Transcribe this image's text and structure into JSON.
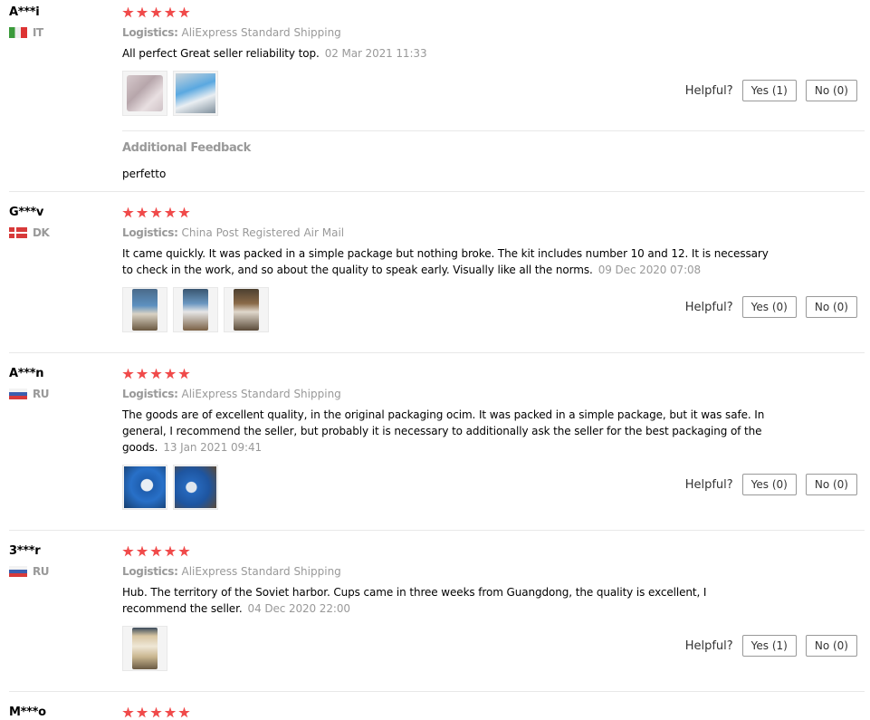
{
  "helpful_label": "Helpful?",
  "logistics_label": "Logistics:",
  "colors": {
    "star": "#f04a4a",
    "muted": "#999999",
    "border": "#e8e8e8"
  },
  "reviews": [
    {
      "user": "A***i",
      "country": "IT",
      "flag": "it",
      "rating": 5,
      "logistics": "AliExpress Standard Shipping",
      "content": "All perfect Great seller reliability top.",
      "date": "02 Mar 2021 11:33",
      "yes": "Yes (1)",
      "no": "No (0)",
      "additional_feedback": {
        "title": "Additional Feedback",
        "text": "perfetto"
      }
    },
    {
      "user": "G***v",
      "country": "DK",
      "flag": "dk",
      "rating": 5,
      "logistics": "China Post Registered Air Mail",
      "content": "It came quickly. It was packed in a simple package but nothing broke. The kit includes number 10 and 12. It is necessary to check in the work, and so about the quality to speak early. Visually like all the norms.",
      "date": "09 Dec 2020 07:08",
      "yes": "Yes (0)",
      "no": "No (0)"
    },
    {
      "user": "A***n",
      "country": "RU",
      "flag": "ru",
      "rating": 5,
      "logistics": "AliExpress Standard Shipping",
      "content": "The goods are of excellent quality, in the original packaging ocim. It was packed in a simple package, but it was safe. In general, I recommend the seller, but probably it is necessary to additionally ask the seller for the best packaging of the goods.",
      "date": "13 Jan 2021 09:41",
      "yes": "Yes (0)",
      "no": "No (0)"
    },
    {
      "user": "3***r",
      "country": "RU",
      "flag": "ru",
      "rating": 5,
      "logistics": "AliExpress Standard Shipping",
      "content": "Hub. The territory of the Soviet harbor. Cups came in three weeks from Guangdong, the quality is excellent, I recommend the seller.",
      "date": "04 Dec 2020 22:00",
      "yes": "Yes (1)",
      "no": "No (0)"
    },
    {
      "user": "M***o",
      "rating": 5
    }
  ]
}
